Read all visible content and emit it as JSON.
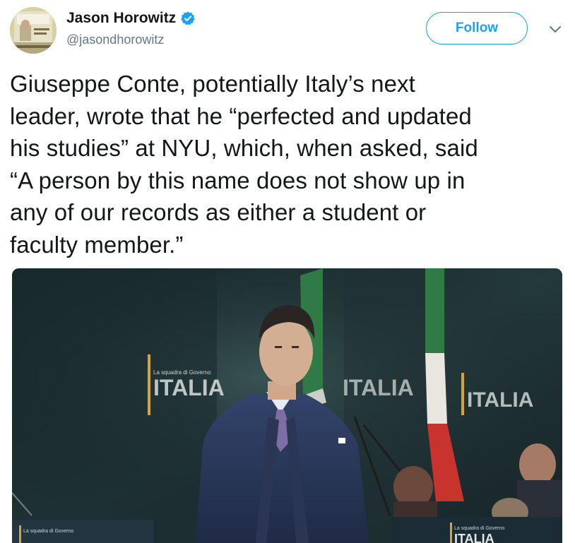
{
  "author": {
    "display_name": "Jason Horowitz",
    "handle": "@jasondhorowitz",
    "verified": true,
    "avatar_icon": "avatar-photo"
  },
  "actions": {
    "follow_label": "Follow",
    "menu_icon": "chevron-down-icon"
  },
  "tweet": {
    "lines": [
      "Giuseppe Conte, potentially Italy’s next",
      "leader, wrote that he “perfected and updated",
      "his studies” at NYU, which, when asked, said",
      "“A person by this name does not show up in",
      "any of our records as either a student or",
      "faculty member.”"
    ]
  },
  "media": {
    "backdrop_words": [
      "ITALIA",
      "ITALIA",
      "ITALIA",
      "ITALIA"
    ],
    "backdrop_sub": "La squadra di Governo",
    "colors": {
      "backdrop": "#1b2a2c",
      "flag_green": "#2f7a45",
      "flag_white": "#e9e6df",
      "flag_red": "#c8332e",
      "gold_bar": "#d6a53a"
    }
  },
  "colors": {
    "accent": "#1da1f2",
    "text": "#14171a",
    "secondary_text": "#657786"
  }
}
